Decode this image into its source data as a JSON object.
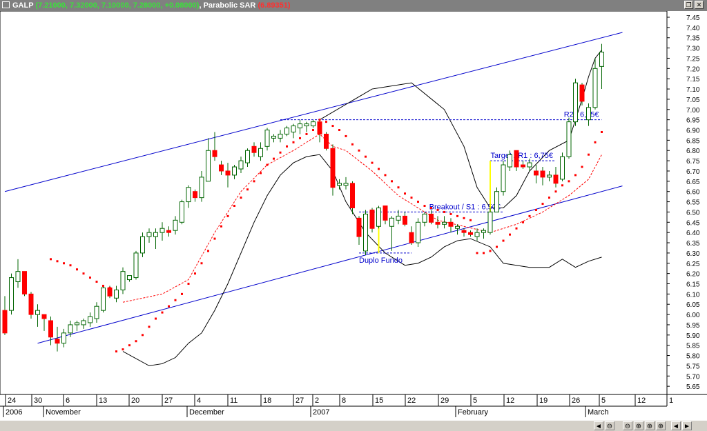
{
  "window": {
    "symbol": "GALP",
    "ohlc_text": "(7.21000, 7.32000, 7.10000, 7.28000, +0.08000)",
    "indicator_name": "Parabolic SAR",
    "indicator_value": "(6.89351)",
    "restore_icon": "restore-icon",
    "close_icon": "close-icon"
  },
  "chart_data": {
    "type": "candlestick",
    "title": "",
    "ylim": [
      5.6,
      7.48
    ],
    "y_ticks": [
      "7.45",
      "7.40",
      "7.35",
      "7.30",
      "7.25",
      "7.20",
      "7.15",
      "7.10",
      "7.05",
      "7.00",
      "6.95",
      "6.90",
      "6.85",
      "6.80",
      "6.75",
      "6.70",
      "6.65",
      "6.60",
      "6.55",
      "6.50",
      "6.45",
      "6.40",
      "6.35",
      "6.30",
      "6.25",
      "6.20",
      "6.15",
      "6.10",
      "6.05",
      "6.00",
      "5.95",
      "5.90",
      "5.85",
      "5.80",
      "5.75",
      "5.70",
      "5.65"
    ],
    "day_labels": [
      "24",
      "30",
      "6",
      "13",
      "20",
      "27",
      "4",
      "11",
      "18",
      "27",
      "2",
      "8",
      "15",
      "22",
      "29",
      "5",
      "12",
      "19",
      "26",
      "5",
      "12",
      "1"
    ],
    "month_labels": [
      "2006",
      "November",
      "December",
      "2007",
      "February",
      "March"
    ],
    "colors": {
      "up": "#ffffff",
      "down": "#ff0000",
      "sar": "#ff0000",
      "trend": "#0000cc",
      "bollinger": "#000000",
      "annotation": "#0000cc",
      "highlight": "#ffff00"
    },
    "candles": [
      [
        6.02,
        6.09,
        5.9,
        5.91
      ],
      [
        6.02,
        6.2,
        6.0,
        6.18
      ],
      [
        6.16,
        6.27,
        6.13,
        6.21
      ],
      [
        6.21,
        6.21,
        6.09,
        6.1
      ],
      [
        6.1,
        6.11,
        5.98,
        6.0
      ],
      [
        6.0,
        6.05,
        5.94,
        6.02
      ],
      [
        6.0,
        6.0,
        5.92,
        5.98
      ],
      [
        5.97,
        5.99,
        5.85,
        5.89
      ],
      [
        5.88,
        5.94,
        5.82,
        5.86
      ],
      [
        5.86,
        5.93,
        5.84,
        5.91
      ],
      [
        5.91,
        5.97,
        5.89,
        5.95
      ],
      [
        5.95,
        5.97,
        5.92,
        5.96
      ],
      [
        5.95,
        5.98,
        5.93,
        5.97
      ],
      [
        5.96,
        6.01,
        5.94,
        5.99
      ],
      [
        5.98,
        6.06,
        5.96,
        6.04
      ],
      [
        6.02,
        6.14,
        6.01,
        6.13
      ],
      [
        6.13,
        6.14,
        6.08,
        6.09
      ],
      [
        6.08,
        6.14,
        6.06,
        6.12
      ],
      [
        6.12,
        6.23,
        6.1,
        6.21
      ],
      [
        6.17,
        6.19,
        6.16,
        6.19
      ],
      [
        6.18,
        6.31,
        6.17,
        6.3
      ],
      [
        6.3,
        6.4,
        6.28,
        6.38
      ],
      [
        6.38,
        6.42,
        6.35,
        6.4
      ],
      [
        6.38,
        6.42,
        6.32,
        6.4
      ],
      [
        6.4,
        6.45,
        6.36,
        6.42
      ],
      [
        6.41,
        6.43,
        6.38,
        6.4
      ],
      [
        6.41,
        6.48,
        6.39,
        6.46
      ],
      [
        6.45,
        6.56,
        6.44,
        6.55
      ],
      [
        6.55,
        6.63,
        6.52,
        6.62
      ],
      [
        6.6,
        6.61,
        6.55,
        6.57
      ],
      [
        6.57,
        6.7,
        6.55,
        6.67
      ],
      [
        6.65,
        6.86,
        6.65,
        6.8
      ],
      [
        6.8,
        6.89,
        6.75,
        6.77
      ],
      [
        6.73,
        6.75,
        6.68,
        6.7
      ],
      [
        6.7,
        6.74,
        6.62,
        6.68
      ],
      [
        6.68,
        6.73,
        6.66,
        6.72
      ],
      [
        6.71,
        6.77,
        6.69,
        6.75
      ],
      [
        6.74,
        6.81,
        6.72,
        6.8
      ],
      [
        6.82,
        6.84,
        6.77,
        6.79
      ],
      [
        6.77,
        6.84,
        6.75,
        6.81
      ],
      [
        6.82,
        6.91,
        6.8,
        6.9
      ],
      [
        6.86,
        6.88,
        6.84,
        6.87
      ],
      [
        6.86,
        6.9,
        6.84,
        6.88
      ],
      [
        6.88,
        6.92,
        6.87,
        6.91
      ],
      [
        6.89,
        6.93,
        6.86,
        6.92
      ],
      [
        6.91,
        6.95,
        6.88,
        6.93
      ],
      [
        6.92,
        6.94,
        6.89,
        6.93
      ],
      [
        6.92,
        6.95,
        6.91,
        6.94
      ],
      [
        6.94,
        6.95,
        6.84,
        6.88
      ],
      [
        6.88,
        6.89,
        6.8,
        6.81
      ],
      [
        6.81,
        6.83,
        6.58,
        6.62
      ],
      [
        6.63,
        6.66,
        6.61,
        6.64
      ],
      [
        6.63,
        6.67,
        6.61,
        6.64
      ],
      [
        6.64,
        6.65,
        6.49,
        6.52
      ],
      [
        6.47,
        6.48,
        6.34,
        6.38
      ],
      [
        6.31,
        6.51,
        6.29,
        6.49
      ],
      [
        6.51,
        6.52,
        6.4,
        6.42
      ],
      [
        6.43,
        6.53,
        6.42,
        6.52
      ],
      [
        6.53,
        6.53,
        6.44,
        6.46
      ],
      [
        6.43,
        6.48,
        6.31,
        6.47
      ],
      [
        6.46,
        6.51,
        6.44,
        6.48
      ],
      [
        6.48,
        6.5,
        6.43,
        6.44
      ],
      [
        6.4,
        6.43,
        6.34,
        6.35
      ],
      [
        6.35,
        6.47,
        6.33,
        6.45
      ],
      [
        6.45,
        6.5,
        6.43,
        6.49
      ],
      [
        6.49,
        6.51,
        6.44,
        6.45
      ],
      [
        6.45,
        6.48,
        6.42,
        6.44
      ],
      [
        6.44,
        6.48,
        6.42,
        6.45
      ],
      [
        6.45,
        6.47,
        6.4,
        6.43
      ],
      [
        6.42,
        6.44,
        6.39,
        6.43
      ],
      [
        6.41,
        6.42,
        6.38,
        6.4
      ],
      [
        6.4,
        6.41,
        6.38,
        6.39
      ],
      [
        6.38,
        6.42,
        6.36,
        6.4
      ],
      [
        6.4,
        6.42,
        6.37,
        6.41
      ],
      [
        6.4,
        6.52,
        6.39,
        6.5
      ],
      [
        6.5,
        6.62,
        6.5,
        6.6
      ],
      [
        6.6,
        6.75,
        6.58,
        6.73
      ],
      [
        6.72,
        6.8,
        6.7,
        6.78
      ],
      [
        6.8,
        6.79,
        6.7,
        6.72
      ],
      [
        6.73,
        6.75,
        6.71,
        6.72
      ],
      [
        6.72,
        6.76,
        6.7,
        6.74
      ],
      [
        6.7,
        6.73,
        6.64,
        6.68
      ],
      [
        6.7,
        6.72,
        6.63,
        6.67
      ],
      [
        6.67,
        6.7,
        6.65,
        6.68
      ],
      [
        6.68,
        6.72,
        6.62,
        6.64
      ],
      [
        6.66,
        6.79,
        6.65,
        6.77
      ],
      [
        6.77,
        6.96,
        6.76,
        6.94
      ],
      [
        6.94,
        7.15,
        6.92,
        7.13
      ],
      [
        7.12,
        7.13,
        7.02,
        7.04
      ],
      [
        6.95,
        7.03,
        6.92,
        7.01
      ],
      [
        7.01,
        7.25,
        7.0,
        7.2
      ],
      [
        7.21,
        7.32,
        7.1,
        7.28
      ]
    ],
    "sar": [
      [
        7,
        6.27
      ],
      [
        8,
        6.26
      ],
      [
        9,
        6.25
      ],
      [
        10,
        6.24
      ],
      [
        11,
        6.22
      ],
      [
        12,
        6.2
      ],
      [
        13,
        6.18
      ],
      [
        14,
        6.16
      ],
      [
        15,
        6.14
      ],
      [
        16,
        6.13
      ],
      [
        17,
        5.82
      ],
      [
        18,
        5.83
      ],
      [
        19,
        5.85
      ],
      [
        20,
        5.87
      ],
      [
        21,
        5.9
      ],
      [
        22,
        5.94
      ],
      [
        23,
        5.98
      ],
      [
        24,
        6.01
      ],
      [
        25,
        6.04
      ],
      [
        26,
        6.07
      ],
      [
        27,
        6.1
      ],
      [
        28,
        6.15
      ],
      [
        29,
        6.2
      ],
      [
        30,
        6.25
      ],
      [
        31,
        6.31
      ],
      [
        32,
        6.37
      ],
      [
        33,
        6.43
      ],
      [
        34,
        6.48
      ],
      [
        35,
        6.53
      ],
      [
        36,
        6.57
      ],
      [
        37,
        6.61
      ],
      [
        38,
        6.65
      ],
      [
        39,
        6.69
      ],
      [
        40,
        6.73
      ],
      [
        41,
        6.76
      ],
      [
        42,
        6.79
      ],
      [
        43,
        6.82
      ],
      [
        44,
        6.84
      ],
      [
        45,
        6.86
      ],
      [
        46,
        6.88
      ],
      [
        47,
        6.9
      ],
      [
        48,
        6.95
      ],
      [
        49,
        6.94
      ],
      [
        50,
        6.92
      ],
      [
        51,
        6.9
      ],
      [
        52,
        6.87
      ],
      [
        53,
        6.83
      ],
      [
        54,
        6.8
      ],
      [
        55,
        6.77
      ],
      [
        56,
        6.74
      ],
      [
        57,
        6.71
      ],
      [
        58,
        6.68
      ],
      [
        59,
        6.65
      ],
      [
        60,
        6.62
      ],
      [
        61,
        6.59
      ],
      [
        62,
        6.57
      ],
      [
        63,
        6.55
      ],
      [
        64,
        6.53
      ],
      [
        65,
        6.52
      ],
      [
        66,
        6.51
      ],
      [
        67,
        6.5
      ],
      [
        68,
        6.49
      ],
      [
        69,
        6.48
      ],
      [
        70,
        6.47
      ],
      [
        71,
        6.46
      ],
      [
        72,
        6.3
      ],
      [
        73,
        6.3
      ],
      [
        74,
        6.31
      ],
      [
        75,
        6.33
      ],
      [
        76,
        6.36
      ],
      [
        77,
        6.39
      ],
      [
        78,
        6.42
      ],
      [
        79,
        6.45
      ],
      [
        80,
        6.48
      ],
      [
        81,
        6.51
      ],
      [
        82,
        6.54
      ],
      [
        83,
        6.57
      ],
      [
        84,
        6.6
      ],
      [
        85,
        6.63
      ],
      [
        86,
        6.65
      ],
      [
        87,
        6.68
      ],
      [
        88,
        6.72
      ],
      [
        89,
        6.78
      ],
      [
        90,
        6.84
      ],
      [
        91,
        6.89
      ]
    ],
    "bb_upper": [
      [
        48,
        6.95
      ],
      [
        56,
        7.1
      ],
      [
        62,
        7.13
      ],
      [
        67,
        7.0
      ],
      [
        70,
        6.82
      ],
      [
        72,
        6.62
      ],
      [
        74,
        6.52
      ],
      [
        76,
        6.52
      ],
      [
        78,
        6.58
      ],
      [
        80,
        6.7
      ],
      [
        83,
        6.8
      ],
      [
        86,
        6.85
      ],
      [
        88,
        7.05
      ],
      [
        89,
        7.16
      ],
      [
        90,
        7.25
      ],
      [
        91,
        7.29
      ]
    ],
    "bb_lower": [
      [
        18,
        5.82
      ],
      [
        22,
        5.75
      ],
      [
        24,
        5.76
      ],
      [
        26,
        5.79
      ],
      [
        28,
        5.86
      ],
      [
        30,
        5.91
      ],
      [
        32,
        6.02
      ],
      [
        34,
        6.15
      ],
      [
        36,
        6.3
      ],
      [
        38,
        6.45
      ],
      [
        40,
        6.58
      ],
      [
        42,
        6.68
      ],
      [
        44,
        6.74
      ],
      [
        46,
        6.77
      ],
      [
        48,
        6.78
      ],
      [
        50,
        6.7
      ],
      [
        52,
        6.55
      ],
      [
        55,
        6.4
      ],
      [
        58,
        6.3
      ],
      [
        61,
        6.24
      ],
      [
        63,
        6.25
      ],
      [
        65,
        6.28
      ],
      [
        67,
        6.33
      ],
      [
        69,
        6.36
      ],
      [
        71,
        6.37
      ],
      [
        74,
        6.33
      ],
      [
        76,
        6.25
      ],
      [
        80,
        6.23
      ],
      [
        83,
        6.23
      ],
      [
        85,
        6.27
      ],
      [
        87,
        6.23
      ],
      [
        89,
        6.26
      ],
      [
        91,
        6.28
      ]
    ],
    "bb_mid": [
      [
        18,
        6.06
      ],
      [
        24,
        6.1
      ],
      [
        28,
        6.17
      ],
      [
        32,
        6.4
      ],
      [
        36,
        6.6
      ],
      [
        40,
        6.73
      ],
      [
        44,
        6.8
      ],
      [
        48,
        6.88
      ],
      [
        50,
        6.82
      ],
      [
        52,
        6.8
      ],
      [
        56,
        6.7
      ],
      [
        60,
        6.58
      ],
      [
        64,
        6.5
      ],
      [
        66,
        6.46
      ],
      [
        70,
        6.43
      ],
      [
        74,
        6.4
      ],
      [
        78,
        6.44
      ],
      [
        82,
        6.5
      ],
      [
        86,
        6.58
      ],
      [
        89,
        6.66
      ],
      [
        91,
        6.78
      ]
    ],
    "trend_upper": [
      [
        0,
        6.6
      ],
      [
        91,
        7.35
      ]
    ],
    "trend_lower": [
      [
        5,
        5.86
      ],
      [
        91,
        6.6
      ]
    ],
    "levels": [
      {
        "label": "R2 : 6,95€",
        "value": 6.95,
        "from": 42,
        "to": 91
      },
      {
        "label": "Target / R1 : 6,75€",
        "value": 6.75,
        "from": 74,
        "to": 84
      },
      {
        "label": "Breakout / S1 : 6,50€",
        "value": 6.5,
        "from": 54,
        "to": 76
      },
      {
        "label": "Duplo Fundo",
        "value": 6.3,
        "from": 54,
        "to": 62
      }
    ]
  },
  "statusbar": {
    "buttons": [
      "◄ ►",
      "⊖",
      "⊕",
      "⊖",
      "⊕",
      "⊕",
      "◄",
      "►"
    ]
  }
}
